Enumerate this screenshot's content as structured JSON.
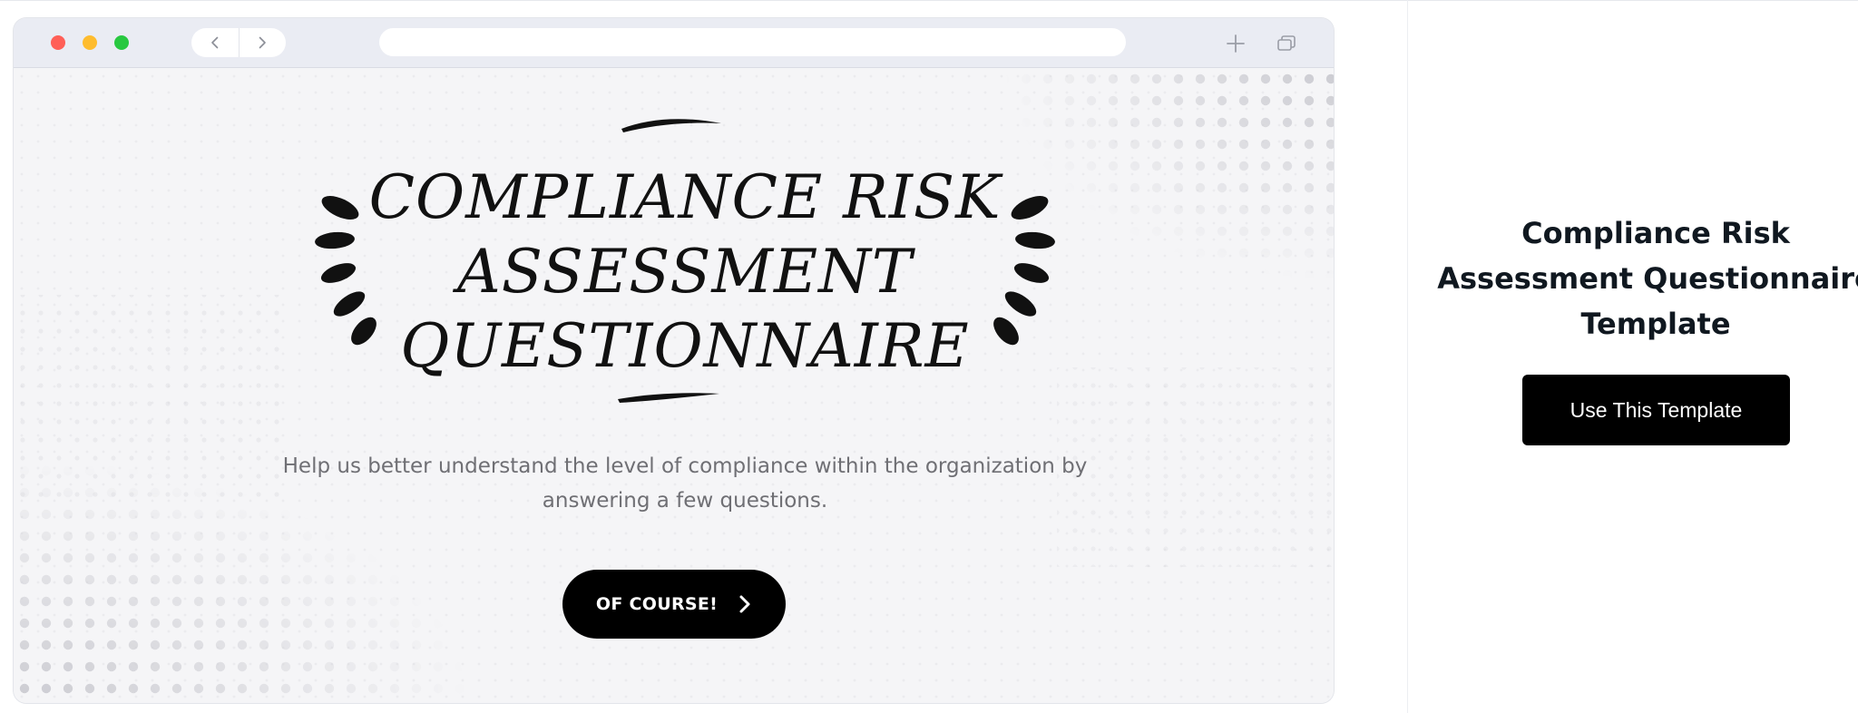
{
  "browser": {
    "window_controls": [
      "close",
      "minimize",
      "maximize"
    ],
    "colors": {
      "close": "#ff5f57",
      "minimize": "#febc2e",
      "maximize": "#28c840"
    },
    "nav": {
      "back_icon": "chevron-left-icon",
      "forward_icon": "chevron-right-icon"
    },
    "address_bar": {
      "value": ""
    },
    "actions": {
      "new_tab_icon": "plus-icon",
      "tabs_icon": "tabs-icon"
    }
  },
  "hero": {
    "title_lines": [
      "COMPLIANCE RISK",
      "ASSESSMENT",
      "QUESTIONNAIRE"
    ],
    "subtitle": "Help us better understand the level of compliance within the organization by answering a few questions.",
    "cta_label": "OF COURSE!",
    "cta_icon": "chevron-right-icon"
  },
  "panel": {
    "title": "Compliance Risk Assessment Questionnaire Template",
    "button_label": "Use This Template"
  }
}
